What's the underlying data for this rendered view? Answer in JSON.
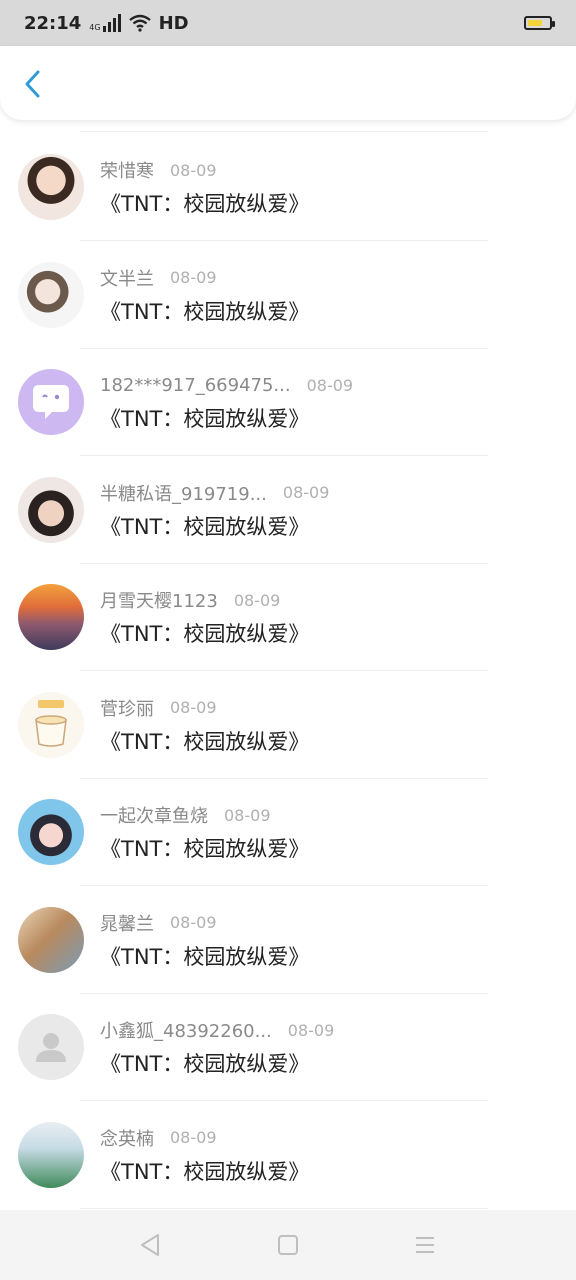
{
  "status_bar": {
    "time": "22:14",
    "network": "4G",
    "hd": "HD",
    "battery_level": 0.7,
    "battery_color": "#f2d43a"
  },
  "header": {
    "back_icon": "chevron-left-icon",
    "accent_color": "#2f9bd6"
  },
  "items": [
    {
      "name": "荣惜寒",
      "date": "08-09",
      "title": "《TNT：校园放纵爱》"
    },
    {
      "name": "文半兰",
      "date": "08-09",
      "title": "《TNT：校园放纵爱》"
    },
    {
      "name": "182***917_669475...",
      "date": "08-09",
      "title": "《TNT：校园放纵爱》"
    },
    {
      "name": "半糖私语_919719...",
      "date": "08-09",
      "title": "《TNT：校园放纵爱》"
    },
    {
      "name": "月雪天樱1123",
      "date": "08-09",
      "title": "《TNT：校园放纵爱》"
    },
    {
      "name": "菅珍丽",
      "date": "08-09",
      "title": "《TNT：校园放纵爱》"
    },
    {
      "name": "一起次章鱼烧",
      "date": "08-09",
      "title": "《TNT：校园放纵爱》"
    },
    {
      "name": "晁馨兰",
      "date": "08-09",
      "title": "《TNT：校园放纵爱》"
    },
    {
      "name": "小鑫狐_48392260...",
      "date": "08-09",
      "title": "《TNT：校园放纵爱》"
    },
    {
      "name": "念英楠",
      "date": "08-09",
      "title": "《TNT：校园放纵爱》"
    }
  ],
  "nav_bar": {
    "back": "triangle-back-icon",
    "home": "square-home-icon",
    "menu": "menu-lines-icon"
  }
}
